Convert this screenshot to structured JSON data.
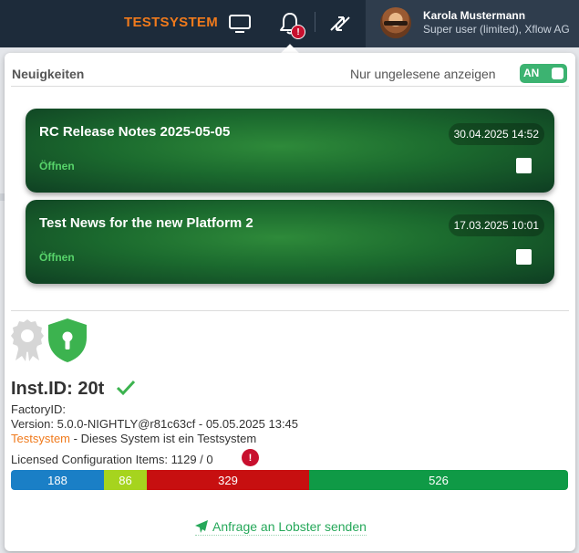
{
  "topbar": {
    "system_label": "TESTSYSTEM",
    "bell_badge": "!",
    "user_name": "Karola Mustermann",
    "user_role": "Super user (limited), Xflow AG"
  },
  "news": {
    "title": "Neuigkeiten",
    "unread_label": "Nur ungelesene anzeigen",
    "toggle_label": "AN",
    "items": [
      {
        "title": "RC Release Notes 2025-05-05",
        "date": "30.04.2025 14:52",
        "open_label": "Öffnen"
      },
      {
        "title": "Test News for the new Platform 2",
        "date": "17.03.2025 10:01",
        "open_label": "Öffnen"
      }
    ]
  },
  "instance": {
    "id_label": "Inst.ID: 20t",
    "factory_label": "FactoryID:",
    "version": "Version: 5.0.0-NIGHTLY@r81c63cf - 05.05.2025 13:45",
    "system_type": "Testsystem",
    "system_desc": " - Dieses System ist ein Testsystem",
    "licensed_label": "Licensed Configuration Items: 1129 / 0",
    "licensed_badge": "!"
  },
  "usage_bar": {
    "segments": [
      {
        "value": "188",
        "color": "#1a7fc6"
      },
      {
        "value": "86",
        "color": "#a6d41e"
      },
      {
        "value": "329",
        "color": "#c70f10"
      },
      {
        "value": "526",
        "color": "#0f9a46"
      }
    ]
  },
  "footer": {
    "send_label": "Anfrage an Lobster senden"
  }
}
